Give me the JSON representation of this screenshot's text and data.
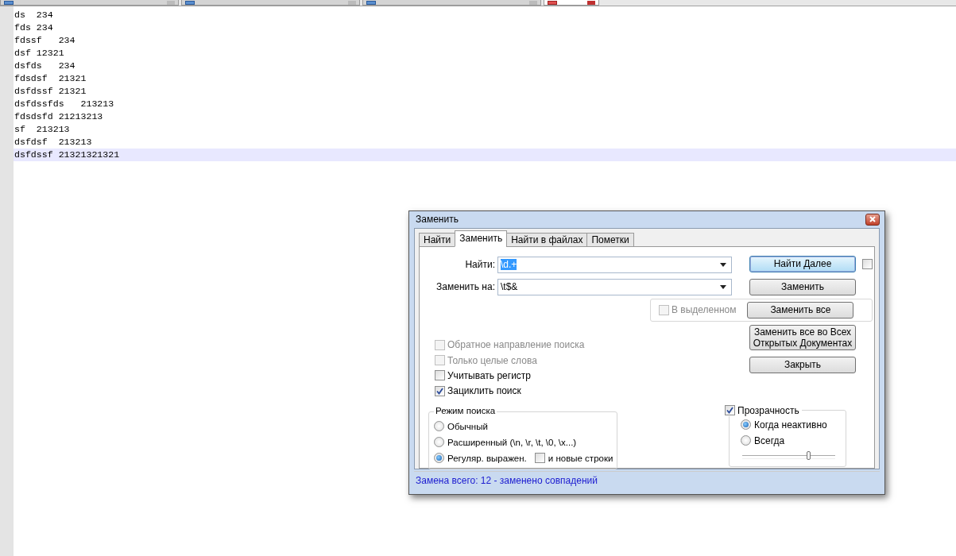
{
  "editor_tabs": [
    {
      "selected": false
    },
    {
      "selected": false
    },
    {
      "selected": false
    },
    {
      "selected": true
    }
  ],
  "editor": {
    "lines": [
      {
        "text": "ds  234",
        "current": false
      },
      {
        "text": "fds 234",
        "current": false
      },
      {
        "text": "fdssf   234",
        "current": false
      },
      {
        "text": "dsf 12321",
        "current": false
      },
      {
        "text": "dsfds   234",
        "current": false
      },
      {
        "text": "fdsdsf  21321",
        "current": false
      },
      {
        "text": "dsfdssf 21321",
        "current": false
      },
      {
        "text": "dsfdssfds   213213",
        "current": false
      },
      {
        "text": "fdsdsfd 21213213",
        "current": false
      },
      {
        "text": "sf  213213",
        "current": false
      },
      {
        "text": "dsfdsf  213213",
        "current": false
      },
      {
        "text": "dsfdssf 21321321321",
        "current": true
      }
    ]
  },
  "dialog": {
    "title": "Заменить",
    "tabs": [
      {
        "label": "Найти",
        "selected": false
      },
      {
        "label": "Заменить",
        "selected": true
      },
      {
        "label": "Найти в файлах",
        "selected": false
      },
      {
        "label": "Пометки",
        "selected": false
      }
    ],
    "fields": [
      {
        "label": "Найти:",
        "value": "\\d.+",
        "value_selected": true
      },
      {
        "label": "Заменить на:",
        "value": "\\t$&",
        "value_selected": false
      }
    ],
    "buttons": [
      {
        "label": "Найти Далее",
        "kind": "default"
      },
      {
        "label": "Заменить",
        "kind": "normal"
      },
      {
        "label": "Заменить все",
        "kind": "normal"
      },
      {
        "label": "Заменить все во Всех Открытых Документах",
        "kind": "normal"
      },
      {
        "label": "Закрыть",
        "kind": "normal"
      }
    ],
    "side_checkbox": {
      "checked": false
    },
    "in_selection": {
      "label": "В выделенном",
      "checked": false,
      "disabled": true
    },
    "options": [
      {
        "label": "Обратное направление поиска",
        "checked": false,
        "disabled": true
      },
      {
        "label": "Только целые слова",
        "checked": false,
        "disabled": true
      },
      {
        "label": "Учитывать регистр",
        "checked": false,
        "disabled": false
      },
      {
        "label": "Зациклить поиск",
        "checked": true,
        "disabled": false
      }
    ],
    "search_mode": {
      "title": "Режим поиска",
      "options": [
        {
          "label": "Обычный",
          "selected": false
        },
        {
          "label": "Расширенный (\\n, \\r, \\t, \\0, \\x...)",
          "selected": false
        },
        {
          "label": "Регуляр. выражен.",
          "selected": true,
          "checkbox": {
            "label": "и новые строки",
            "checked": false
          }
        }
      ]
    },
    "transparency": {
      "label": "Прозрачность",
      "checked": true,
      "options": [
        {
          "label": "Когда неактивно",
          "selected": true
        },
        {
          "label": "Всегда",
          "selected": false
        }
      ],
      "level": 0.71
    },
    "status": "Замена всего: 12 - заменено совпадений"
  }
}
